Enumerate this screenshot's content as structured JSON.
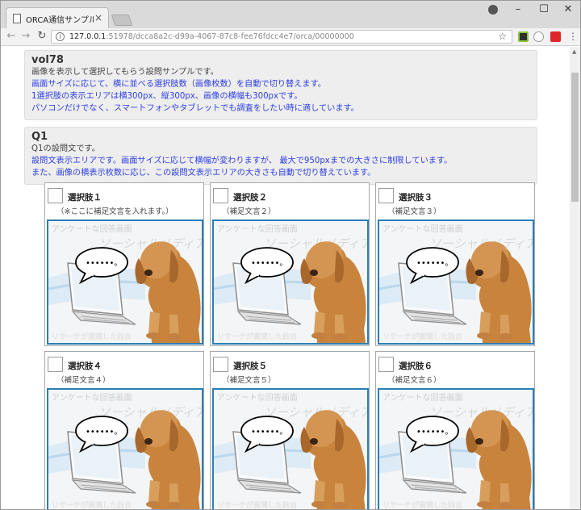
{
  "browser": {
    "tab_title": "ORCA通信サンプルスペック",
    "tab_close": "×",
    "url_host": "127.0.0.1",
    "url_rest": ":51978/dcca8a2c-d99a-4067-87c8-fee76fdcc4e7/orca/00000000"
  },
  "panel_vol": {
    "title": "vol78",
    "lines": [
      "画像を表示して選択してもらう設問サンプルです。",
      "画面サイズに応じて、横に並べる選択肢数（画像枚数）を自動で切り替えます。",
      "1選択肢の表示エリアは横300px、縦300px、画像の横幅も300pxです。",
      "パソコンだけでなく、スマートフォンやタブレットでも調査をしたい時に適しています。"
    ]
  },
  "panel_q1": {
    "title": "Q1",
    "lines": [
      "Q1の設問文です。",
      "設問文表示エリアです。画面サイズに応じて横幅が変わりますが、 最大で950pxまでの大きさに制限しています。",
      "また、画像の横表示枚数に応じ、この設問文表示エリアの大きさも自動で切り替えています。"
    ]
  },
  "choices": [
    {
      "label": "選択肢１",
      "sub": "（※ここに補足文言を入れます。）"
    },
    {
      "label": "選択肢２",
      "sub": "（補足文言２）"
    },
    {
      "label": "選択肢３",
      "sub": "（補足文言３）"
    },
    {
      "label": "選択肢４",
      "sub": "（補足文言４）"
    },
    {
      "label": "選択肢５",
      "sub": "（補足文言５）"
    },
    {
      "label": "選択肢６",
      "sub": "（補足文言６）"
    }
  ],
  "image_overlay": {
    "top_text": "アンケートな回答画面",
    "watermark": "ソーシャルメディア",
    "bubble": "••••••。",
    "bottom_text": "リサーチが実現した独自"
  },
  "colors": {
    "accent_blue_text": "#2d3ee6",
    "image_border": "#2a7fb6",
    "panel_bg": "#eeeeee"
  },
  "icons": [
    "page-icon",
    "back-arrow-icon",
    "forward-arrow-icon",
    "reload-icon",
    "info-icon",
    "star-icon",
    "extension-icon",
    "menu-icon",
    "profile-icon"
  ]
}
